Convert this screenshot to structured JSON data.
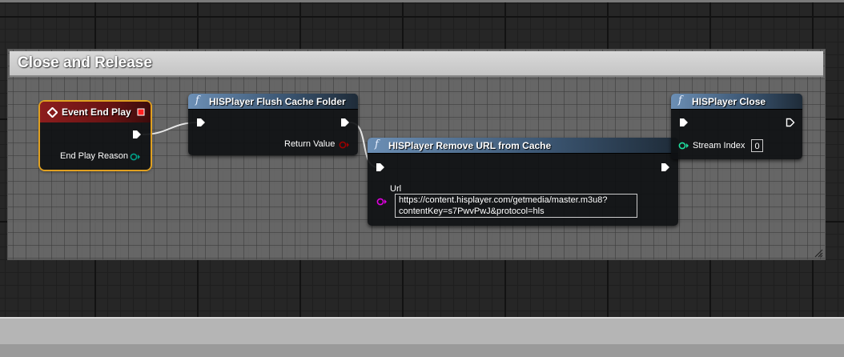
{
  "comment": {
    "title": "Close and Release",
    "color": "#c8c8c8"
  },
  "nodes": {
    "event_end_play": {
      "title": "Event End Play",
      "pin_end_play_reason": "End Play Reason",
      "header_color": "#7a1a1a",
      "icon": "event-diamond-icon"
    },
    "flush_cache": {
      "title": "HISPlayer Flush Cache Folder",
      "pin_return_value": "Return Value",
      "icon": "function-icon"
    },
    "remove_url": {
      "title": "HISPlayer Remove URL from Cache",
      "pin_url_label": "Url",
      "url_value_line1": "https://content.hisplayer.com/getmedia/master.m3u8?",
      "url_value_line2": "contentKey=s7PwvPwJ&protocol=hls",
      "icon": "function-icon"
    },
    "close": {
      "title": "HISPlayer Close",
      "pin_stream_index": "Stream Index",
      "stream_index_value": "0",
      "icon": "function-icon"
    }
  },
  "colors": {
    "function_header": "#4f6f90",
    "string_pin": "#d800d8",
    "int_pin": "#1fe0a0",
    "bool_pin": "#8c0000",
    "enum_pin": "#008470",
    "selection_outline": "#e0a020"
  }
}
